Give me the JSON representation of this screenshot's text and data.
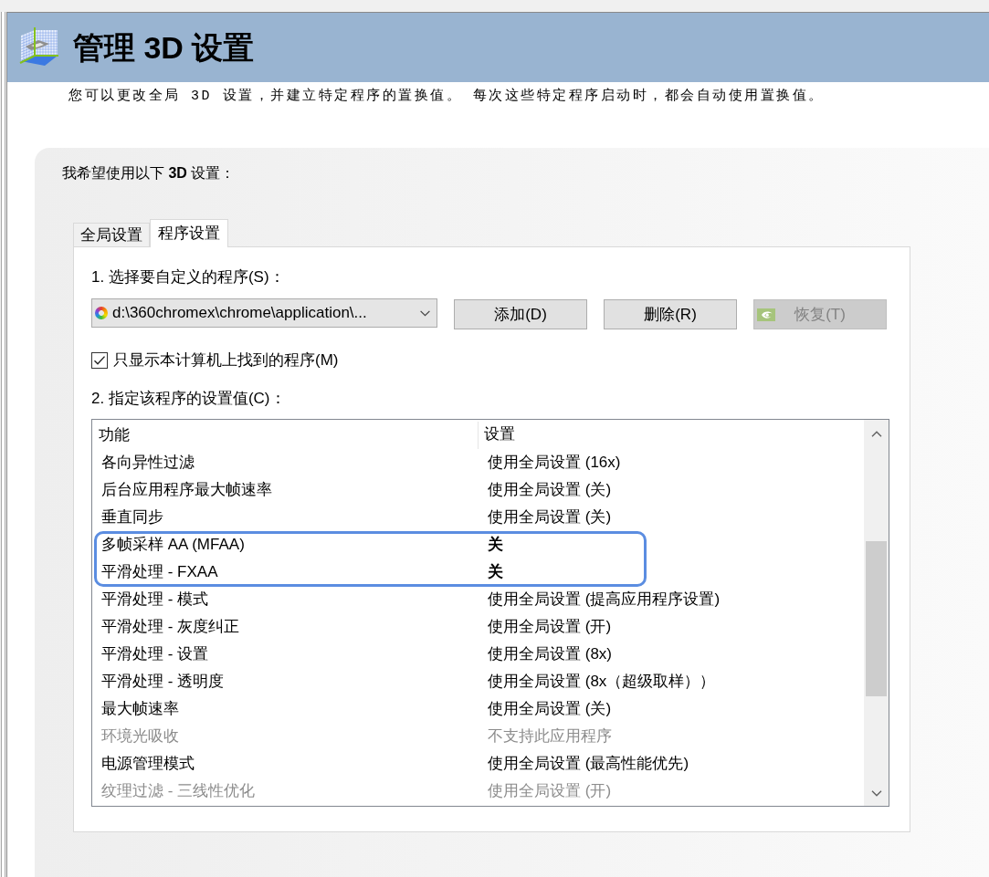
{
  "window": {
    "title": "管理 3D 设置",
    "description": "您可以更改全局 3D 设置，并建立特定程序的置换值。 每次这些特定程序启动时，都会自动使用置换值。"
  },
  "panel": {
    "heading": "我希望使用以下 **3D** 设置："
  },
  "tabs": [
    {
      "label": "全局设置",
      "selected": false
    },
    {
      "label": "程序设置",
      "selected": true
    }
  ],
  "program_settings": {
    "step_1_label": "1. 选择要自定义的程序(S)：",
    "program_dropdown": {
      "value": "d:\\360chromex\\chrome\\application\\..."
    },
    "buttons": [
      {
        "label": "添加(D)",
        "kind": "text",
        "disabled": false
      },
      {
        "label": "删除(R)",
        "kind": "text",
        "disabled": false
      },
      {
        "label": "恢复(T)",
        "kind": "icon",
        "disabled": true
      }
    ],
    "show_found_only": {
      "label": "只显示本计算机上找到的程序(M)",
      "checked": true
    },
    "step_2_label": "2. 指定该程序的设置值(C)：",
    "settings_table": {
      "columns": [
        "功能",
        "设置"
      ],
      "rows": [
        {
          "feature": "各向异性过滤",
          "setting": "使用全局设置 (16x)",
          "modified": false,
          "disabled": false,
          "highlighted": false
        },
        {
          "feature": "后台应用程序最大帧速率",
          "setting": "使用全局设置 (关)",
          "modified": false,
          "disabled": false,
          "highlighted": false
        },
        {
          "feature": "垂直同步",
          "setting": "使用全局设置 (关)",
          "modified": false,
          "disabled": false,
          "highlighted": false
        },
        {
          "feature": "多帧采样 AA (MFAA)",
          "setting": "关",
          "modified": true,
          "disabled": false,
          "highlighted": true
        },
        {
          "feature": "平滑处理 - FXAA",
          "setting": "关",
          "modified": true,
          "disabled": false,
          "highlighted": true
        },
        {
          "feature": "平滑处理 - 模式",
          "setting": "使用全局设置 (提高应用程序设置)",
          "modified": false,
          "disabled": false,
          "highlighted": false
        },
        {
          "feature": "平滑处理 - 灰度纠正",
          "setting": "使用全局设置 (开)",
          "modified": false,
          "disabled": false,
          "highlighted": false
        },
        {
          "feature": "平滑处理 - 设置",
          "setting": "使用全局设置 (8x)",
          "modified": false,
          "disabled": false,
          "highlighted": false
        },
        {
          "feature": "平滑处理 - 透明度",
          "setting": "使用全局设置 (8x（超级取样））",
          "modified": false,
          "disabled": false,
          "highlighted": false
        },
        {
          "feature": "最大帧速率",
          "setting": "使用全局设置 (关)",
          "modified": false,
          "disabled": false,
          "highlighted": false
        },
        {
          "feature": "环境光吸收",
          "setting": "不支持此应用程序",
          "modified": false,
          "disabled": true,
          "highlighted": false
        },
        {
          "feature": "电源管理模式",
          "setting": "使用全局设置 (最高性能优先)",
          "modified": false,
          "disabled": false,
          "highlighted": false
        },
        {
          "feature": "纹理过滤 - 三线性优化",
          "setting": "使用全局设置 (开)",
          "modified": false,
          "disabled": true,
          "highlighted": false
        }
      ]
    }
  }
}
